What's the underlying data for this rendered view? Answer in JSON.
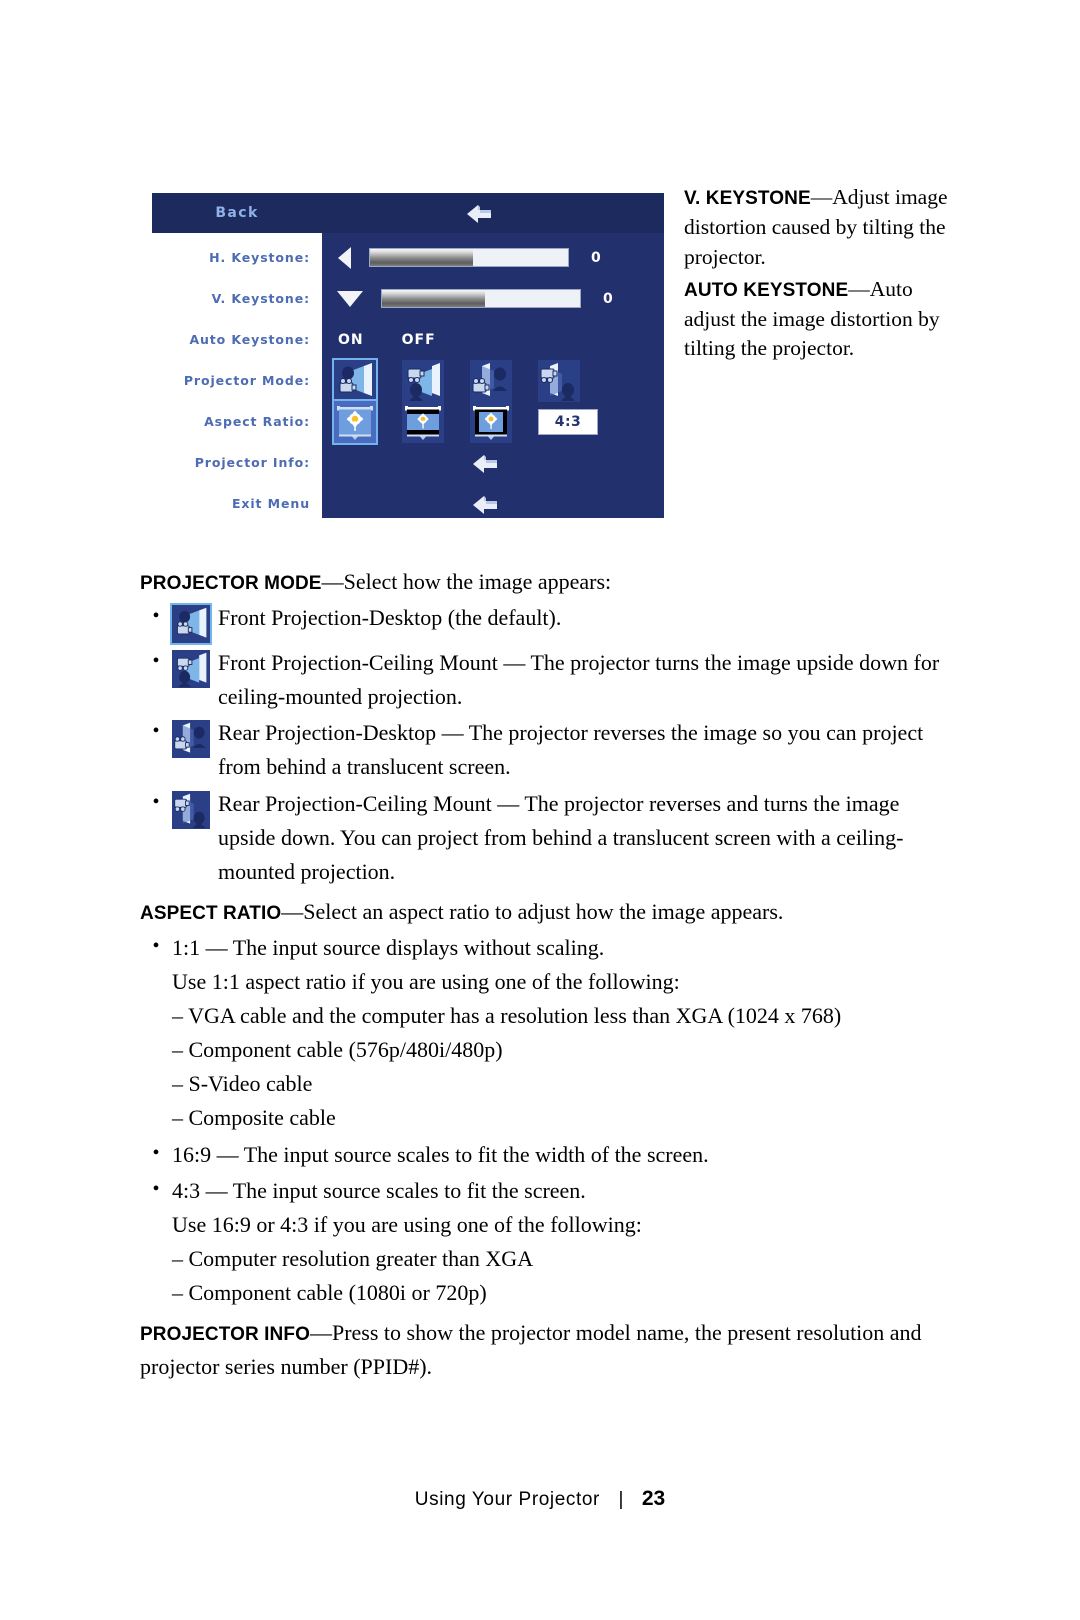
{
  "osd": {
    "header": {
      "title": "Back",
      "icon": "return-arrow-icon"
    },
    "rows": [
      {
        "label": "H. Keystone:",
        "type": "slider",
        "arrow": "left-arrow-icon",
        "value": "0",
        "fill_percent": 52
      },
      {
        "label": "V. Keystone:",
        "type": "slider",
        "arrow": "down-arrow-icon",
        "value": "0",
        "fill_percent": 52
      },
      {
        "label": "Auto Keystone:",
        "type": "onoff",
        "on_label": "ON",
        "off_label": "OFF"
      },
      {
        "label": "Projector Mode:",
        "type": "modes",
        "options": [
          "front-desktop-icon",
          "front-ceiling-icon",
          "rear-desktop-icon",
          "rear-ceiling-icon"
        ],
        "selected_index": 0
      },
      {
        "label": "Aspect Ratio:",
        "type": "ratios",
        "options": [
          "ratio-1-1-icon",
          "ratio-16-9-icon",
          "ratio-4-3-icon"
        ],
        "selected_index": 0,
        "value": "4:3"
      },
      {
        "label": "Projector Info:",
        "type": "action",
        "icon": "return-arrow-icon"
      },
      {
        "label": "Exit Menu",
        "type": "action",
        "icon": "return-arrow-icon"
      }
    ],
    "colors": {
      "header_bg": "#1d2a5e",
      "body_bg": "#22306e",
      "label_bg": "#ffffff",
      "label_text": "#4d6cb4",
      "header_text": "#8fb0e8",
      "highlight": "#74b4ec"
    }
  },
  "side_text": {
    "v_keystone_term": "V. KEYSTONE",
    "v_keystone_body": "—Adjust image distortion caused by tilting the projector.",
    "auto_keystone_term": "AUTO KEYSTONE",
    "auto_keystone_body": "—Auto adjust the image distortion by tilting the projector."
  },
  "body": {
    "projector_mode_term": "PROJECTOR MODE",
    "projector_mode_intro": "—Select how the image appears:",
    "mode_bullets": [
      {
        "icon": "front-desktop-icon",
        "selected": true,
        "text": "Front Projection-Desktop (the default)."
      },
      {
        "icon": "front-ceiling-icon",
        "selected": false,
        "text": "Front Projection-Ceiling Mount — The projector turns the image upside down for ceiling-mounted projection."
      },
      {
        "icon": "rear-desktop-icon",
        "selected": false,
        "text": "Rear Projection-Desktop — The projector reverses the image so you can project from behind a translucent screen."
      },
      {
        "icon": "rear-ceiling-icon",
        "selected": false,
        "text": "Rear Projection-Ceiling Mount — The projector reverses and turns the image upside down. You can project from behind a translucent screen with a ceiling-mounted projection."
      }
    ],
    "aspect_ratio_term": "ASPECT RATIO",
    "aspect_ratio_intro": "—Select an aspect ratio to adjust how the image appears.",
    "ratio_1_1_bullet": "1:1 — The input source displays without scaling.",
    "ratio_1_1_use": "Use 1:1 aspect ratio if you are using one of the following:",
    "ratio_1_1_items": [
      "– VGA cable and the computer has a resolution less than XGA (1024 x 768)",
      "– Component cable (576p/480i/480p)",
      "– S-Video cable",
      "– Composite cable"
    ],
    "ratio_16_9_bullet": "16:9 — The input source scales to fit the width of the screen.",
    "ratio_4_3_bullet": "4:3 — The input source scales to fit the screen.",
    "ratio_169_43_use": "Use 16:9 or 4:3 if you are using one of the following:",
    "ratio_169_43_items": [
      "– Computer resolution greater than XGA",
      "– Component cable (1080i or 720p)"
    ],
    "projector_info_term": "PROJECTOR INFO",
    "projector_info_body": "—Press to show the projector model name, the present resolution and projector series number (PPID#)."
  },
  "footer": {
    "label": "Using Your Projector",
    "separator": "|",
    "page": "23"
  }
}
